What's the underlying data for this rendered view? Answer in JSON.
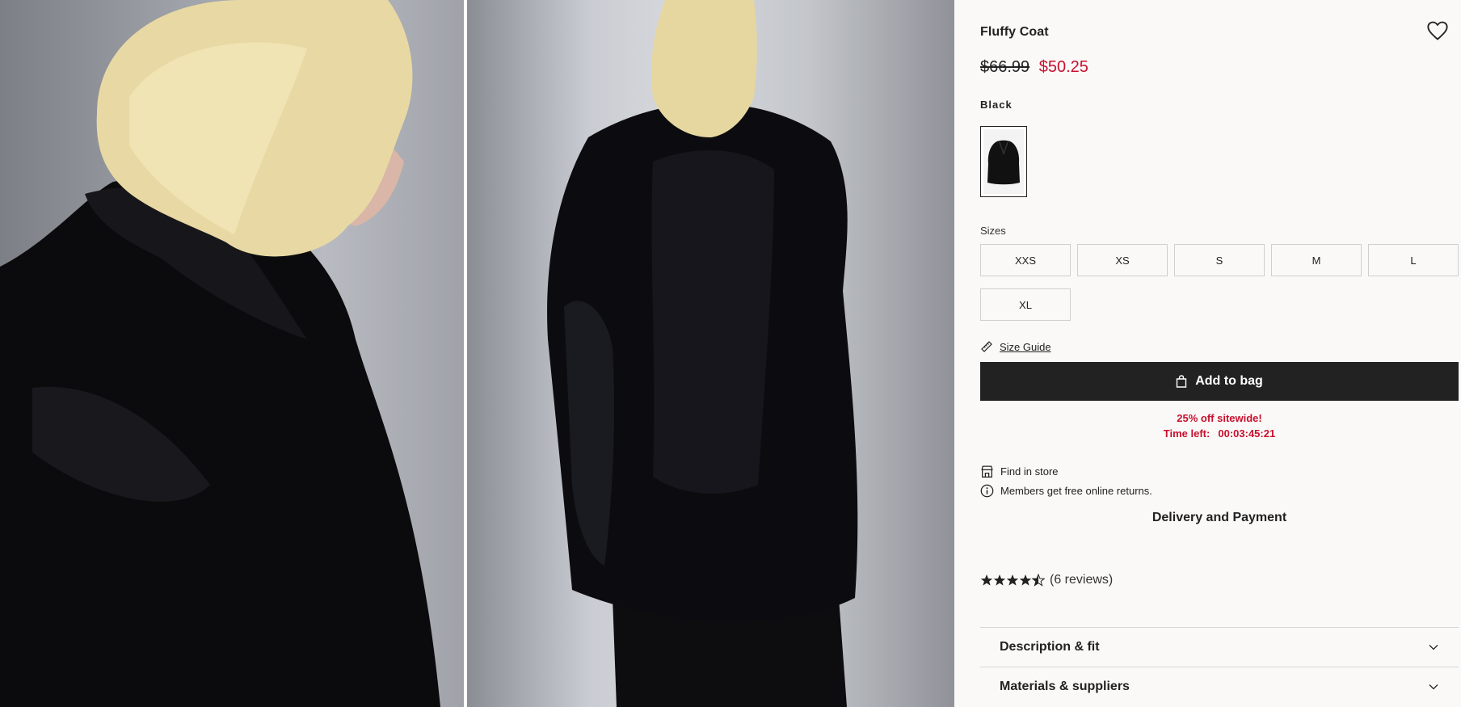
{
  "product": {
    "title": "Fluffy Coat",
    "price_old": "$66.99",
    "price_new": "$50.25",
    "color_label": "Black"
  },
  "sizes": {
    "label": "Sizes",
    "options": [
      "XXS",
      "XS",
      "S",
      "M",
      "L",
      "XL"
    ]
  },
  "actions": {
    "size_guide": "Size Guide",
    "add_to_bag": "Add to bag"
  },
  "promo": {
    "headline": "25% off sitewide!",
    "time_left_label": "Time left:",
    "time_left_value": "00:03:45:21"
  },
  "info": {
    "find_in_store": "Find in store",
    "returns": "Members get free online returns.",
    "delivery": "Delivery and Payment"
  },
  "reviews": {
    "rating": 4.5,
    "count_text": "(6 reviews)"
  },
  "accordions": [
    "Description & fit",
    "Materials & suppliers"
  ],
  "colors": {
    "sale": "#c8102e",
    "primary_button": "#222222",
    "background": "#faf9f8"
  }
}
